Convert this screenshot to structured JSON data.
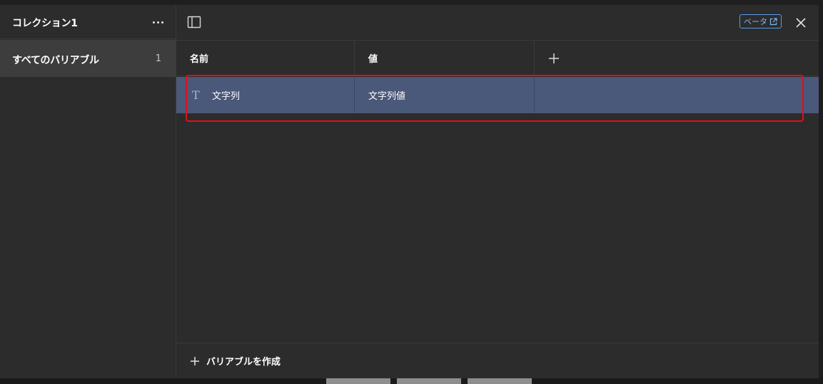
{
  "collection": {
    "title": "コレクション1",
    "more_icon": "more-horizontal-icon"
  },
  "sidebar": {
    "items": [
      {
        "label": "すべてのバリアブル",
        "count": "1"
      }
    ]
  },
  "toolbar": {
    "panel_icon": "sidebar-toggle-icon",
    "beta_label": "ベータ",
    "beta_icon": "external-link-icon",
    "close_icon": "close-icon"
  },
  "table": {
    "columns": [
      "名前",
      "値"
    ],
    "add_column_icon": "plus-icon",
    "rows": [
      {
        "type_icon": "text-type-icon",
        "type_glyph": "T",
        "name": "文字列",
        "value": "文字列値"
      }
    ]
  },
  "footer": {
    "create_label": "バリアブルを作成",
    "create_icon": "plus-icon"
  },
  "colors": {
    "selected_row": "#4a5879",
    "highlight_border": "#e0101a",
    "beta_accent": "#5a9ae8",
    "background": "#2c2c2c"
  }
}
